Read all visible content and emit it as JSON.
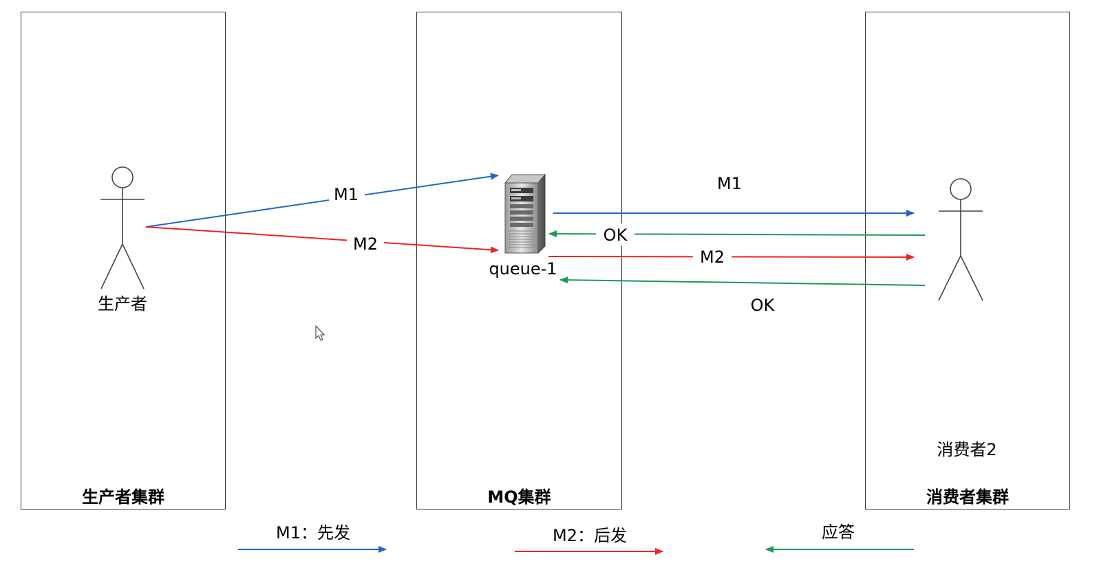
{
  "clusters": {
    "producer": {
      "title": "生产者集群"
    },
    "mq": {
      "title": "MQ集群"
    },
    "consumer": {
      "title": "消费者集群"
    }
  },
  "actors": {
    "producer": {
      "label": "生产者"
    },
    "consumer": {
      "label": "消费者2"
    }
  },
  "server": {
    "label": "queue-1"
  },
  "messages": {
    "m1_to_mq": "M1",
    "m2_to_mq": "M2",
    "m1_to_consumer": "M1",
    "ok_1": "OK",
    "m2_to_consumer": "M2",
    "ok_2": "OK"
  },
  "legend": {
    "m1": "M1：先发",
    "m2": "M2：后发",
    "ack": "应答"
  },
  "colors": {
    "m1": "#2166c4",
    "m2": "#f0231e",
    "ack": "#1a9a55",
    "border": "#333333",
    "actor": "#444444"
  }
}
